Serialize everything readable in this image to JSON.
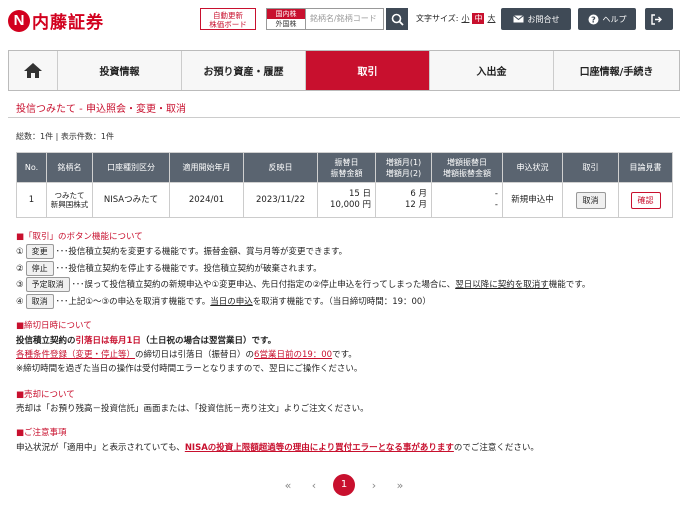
{
  "header": {
    "logo_mark": "N",
    "logo_text": "内藤証券",
    "auto_update_line1": "自動更新",
    "auto_update_line2": "株価ボード",
    "stock_type_top": "国内株",
    "stock_type_bottom": "外国株",
    "search_placeholder": "銘柄名/銘柄コード",
    "font_size_label": "文字サイズ:",
    "font_small": "小",
    "font_medium": "中",
    "font_large": "大",
    "contact_label": "お問合せ",
    "help_label": "ヘルプ"
  },
  "nav": {
    "home": "home",
    "items": [
      "投資情報",
      "お預り資産・履歴",
      "取引",
      "入出金",
      "口座情報/手続き"
    ]
  },
  "page": {
    "title": "投信つみたて - 申込照会・変更・取消",
    "count_text": "総数：1件 | 表示件数：1件"
  },
  "table": {
    "headers": [
      "No.",
      "銘柄名",
      "口座種別区分",
      "適用開始年月",
      "反映日",
      "振替日\n振替金額",
      "増額月(1)\n増額月(2)",
      "増額振替日\n増額振替金額",
      "申込状況",
      "取引",
      "目論見書"
    ],
    "row": {
      "no": "1",
      "name_line1": "つみたて",
      "name_line2": "新興国株式",
      "account": "NISAつみたて",
      "start": "2024/01",
      "reflect": "2023/11/22",
      "transfer_day": "15 日",
      "transfer_amount": "10,000 円",
      "inc_month1": "6 月",
      "inc_month2": "12 月",
      "inc_day": "-",
      "inc_amount": "-",
      "status": "新規申込中",
      "cancel_label": "取消",
      "confirm_label": "確認"
    }
  },
  "notes": {
    "buttons_heading": "■「取引」のボタン機能について",
    "b1_num": "①",
    "b1_btn": "変更",
    "b1_text": "･･･投信積立契約を変更する機能です。振替金額、賞与月等が変更できます。",
    "b2_num": "②",
    "b2_btn": "停止",
    "b2_text": "･･･投信積立契約を停止する機能です。投信積立契約が破棄されます。",
    "b3_num": "③",
    "b3_btn": "予定取消",
    "b3_text_a": "･･･誤って投信積立契約の新規申込や①変更申込、先日付指定の②停止申込を行ってしまった場合に、",
    "b3_text_u": "翌日以降に契約を取消す",
    "b3_text_b": "機能です。",
    "b4_num": "④",
    "b4_btn": "取消",
    "b4_text_a": "･･･上記①～③の申込を取消す機能です。",
    "b4_text_u": "当日の申込",
    "b4_text_b": "を取消す機能です。（当日締切時間：19：00）",
    "deadline_heading": "■締切日時について",
    "d1_a": "投信積立契約の",
    "d1_b": "引落日は毎月1日",
    "d1_c": "（土日祝の場合は翌営業日）です。",
    "d2_a": "各種条件登録（変更・停止等）",
    "d2_b": "の締切日は引落日（振替日）の",
    "d2_c": "6営業日前の19：00",
    "d2_d": "です。",
    "d3": "※締切時間を過ぎた当日の操作は受付時間エラーとなりますので、翌日にご操作ください。",
    "sell_heading": "■売却について",
    "s1": "売却は「お預り残高－投資信託」画面または、「投資信託－売り注文」よりご注文ください。",
    "caution_heading": "■ご注意事項",
    "c1_a": "申込状況が「適用中」と表示されていても、",
    "c1_b": "NISAの投資上限額超過等の理由により買付エラーとなる事があります",
    "c1_c": "のでご注意ください。"
  },
  "pager": {
    "first": "«",
    "prev": "‹",
    "current": "1",
    "next": "›",
    "last": "»"
  }
}
